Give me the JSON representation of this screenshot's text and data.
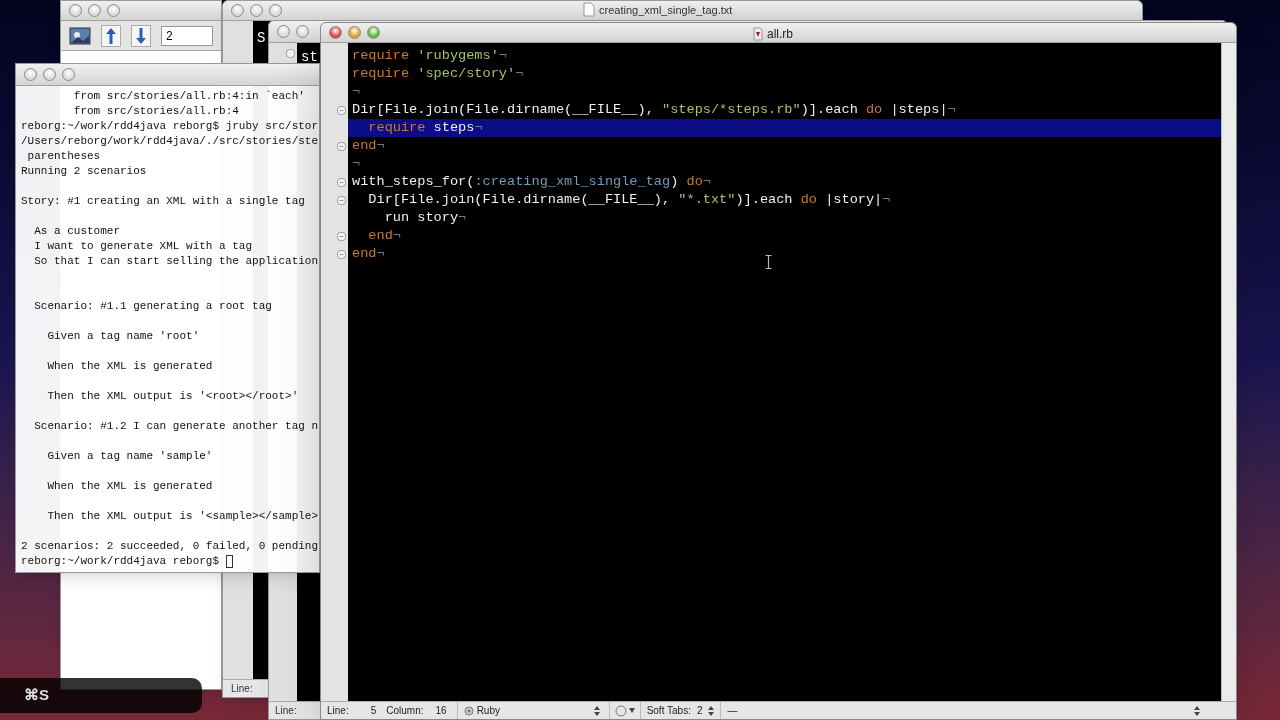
{
  "toolbar_window": {
    "page_field": "2"
  },
  "text_window": {
    "title": "creating_xml_single_tag.txt",
    "visible_text": "S",
    "status_label": "Line:"
  },
  "middle_window": {
    "visible_text": "st",
    "status_label": "Line:"
  },
  "terminal": {
    "lines": [
      {
        "kind": "output",
        "text": "        from src/stories/all.rb:4:in `each'"
      },
      {
        "kind": "output",
        "text": "        from src/stories/all.rb:4"
      },
      {
        "kind": "output",
        "text": "reborg:~/work/rdd4java reborg$ jruby src/stor"
      },
      {
        "kind": "output",
        "text": "/Users/reborg/work/rdd4java/./src/stories/ste"
      },
      {
        "kind": "output",
        "text": " parentheses"
      },
      {
        "kind": "output",
        "text": "Running 2 scenarios"
      },
      {
        "kind": "blank"
      },
      {
        "kind": "output",
        "text": "Story: #1 creating an XML with a single tag"
      },
      {
        "kind": "blank"
      },
      {
        "kind": "output",
        "text": "  As a customer"
      },
      {
        "kind": "output",
        "text": "  I want to generate XML with a tag"
      },
      {
        "kind": "output",
        "text": "  So that I can start selling the application"
      },
      {
        "kind": "blank"
      },
      {
        "kind": "blank"
      },
      {
        "kind": "output",
        "text": "  Scenario: #1.1 generating a root tag"
      },
      {
        "kind": "blank"
      },
      {
        "kind": "output",
        "text": "    Given a tag name 'root'"
      },
      {
        "kind": "blank"
      },
      {
        "kind": "output",
        "text": "    When the XML is generated"
      },
      {
        "kind": "blank"
      },
      {
        "kind": "output",
        "text": "    Then the XML output is '<root></root>'"
      },
      {
        "kind": "blank"
      },
      {
        "kind": "output",
        "text": "  Scenario: #1.2 I can generate another tag n"
      },
      {
        "kind": "blank"
      },
      {
        "kind": "output",
        "text": "    Given a tag name 'sample'"
      },
      {
        "kind": "blank"
      },
      {
        "kind": "output",
        "text": "    When the XML is generated"
      },
      {
        "kind": "blank"
      },
      {
        "kind": "output",
        "text": "    Then the XML output is '<sample></sample>"
      },
      {
        "kind": "blank"
      },
      {
        "kind": "output",
        "text": "2 scenarios: 2 succeeded, 0 failed, 0 pending"
      },
      {
        "kind": "prompt",
        "text": "reborg:~/work/rdd4java reborg$ "
      }
    ]
  },
  "editor": {
    "title": "all.rb",
    "lines": [
      {
        "fold": false,
        "highlighted": false,
        "tokens": [
          {
            "kind": "keyword",
            "text": "require "
          },
          {
            "kind": "string",
            "text": "'rubygems'"
          },
          {
            "kind": "invisible",
            "text": "¬"
          }
        ]
      },
      {
        "fold": false,
        "highlighted": false,
        "tokens": [
          {
            "kind": "keyword",
            "text": "require "
          },
          {
            "kind": "string",
            "text": "'spec/story'"
          },
          {
            "kind": "invisible",
            "text": "¬"
          }
        ]
      },
      {
        "fold": false,
        "highlighted": false,
        "tokens": [
          {
            "kind": "invisible",
            "text": "¬"
          }
        ]
      },
      {
        "fold": true,
        "highlighted": false,
        "tokens": [
          {
            "kind": "plain",
            "text": "Dir[File.join(File.dirname(__FILE__), "
          },
          {
            "kind": "string",
            "text": "\"steps/*steps.rb\""
          },
          {
            "kind": "plain",
            "text": ")].each "
          },
          {
            "kind": "keyword",
            "text": "do"
          },
          {
            "kind": "plain",
            "text": " |steps|"
          },
          {
            "kind": "invisible",
            "text": "¬"
          }
        ]
      },
      {
        "fold": false,
        "highlighted": true,
        "tokens": [
          {
            "kind": "keyword",
            "text": "  require"
          },
          {
            "kind": "plain",
            "text": " steps"
          },
          {
            "kind": "invisible",
            "text": "¬"
          }
        ]
      },
      {
        "fold": true,
        "highlighted": false,
        "tokens": [
          {
            "kind": "keyword",
            "text": "end"
          },
          {
            "kind": "invisible",
            "text": "¬"
          }
        ]
      },
      {
        "fold": false,
        "highlighted": false,
        "tokens": [
          {
            "kind": "invisible",
            "text": "¬"
          }
        ]
      },
      {
        "fold": true,
        "highlighted": false,
        "tokens": [
          {
            "kind": "plain",
            "text": "with_steps_for("
          },
          {
            "kind": "symbol",
            "text": ":creating_xml_single_tag"
          },
          {
            "kind": "plain",
            "text": ") "
          },
          {
            "kind": "keyword",
            "text": "do"
          },
          {
            "kind": "invisible",
            "text": "¬"
          }
        ]
      },
      {
        "fold": true,
        "highlighted": false,
        "tokens": [
          {
            "kind": "plain",
            "text": "  Dir[File.join(File.dirname(__FILE__), "
          },
          {
            "kind": "string",
            "text": "\"*.txt\""
          },
          {
            "kind": "plain",
            "text": ")].each "
          },
          {
            "kind": "keyword",
            "text": "do"
          },
          {
            "kind": "plain",
            "text": " |story|"
          },
          {
            "kind": "invisible",
            "text": "¬"
          }
        ]
      },
      {
        "fold": false,
        "highlighted": false,
        "tokens": [
          {
            "kind": "plain",
            "text": "    run story"
          },
          {
            "kind": "invisible",
            "text": "¬"
          }
        ]
      },
      {
        "fold": true,
        "highlighted": false,
        "tokens": [
          {
            "kind": "keyword",
            "text": "  end"
          },
          {
            "kind": "invisible",
            "text": "¬"
          }
        ]
      },
      {
        "fold": true,
        "highlighted": false,
        "tokens": [
          {
            "kind": "keyword",
            "text": "end"
          },
          {
            "kind": "invisible",
            "text": "¬"
          }
        ]
      }
    ],
    "status_bar": {
      "line_label": "Line:",
      "line": "5",
      "column_label": "Column:",
      "column": "16",
      "language": "Ruby",
      "tabs_label": "Soft Tabs:",
      "tab_size": "2",
      "symbol": "—"
    }
  },
  "hud": {
    "text": "⌘S"
  }
}
